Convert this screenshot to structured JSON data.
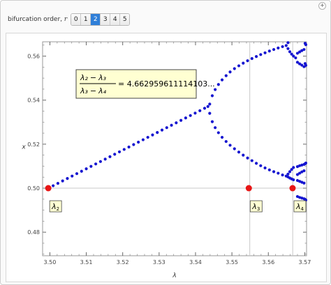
{
  "controls": {
    "label": "bifurcation order,",
    "var": "r",
    "options": [
      "0",
      "1",
      "2",
      "3",
      "4",
      "5"
    ],
    "selected": "2",
    "add_icon": "plus-icon"
  },
  "chart_data": {
    "type": "scatter",
    "xlabel": "λ",
    "ylabel": "x",
    "xlim": [
      3.498,
      3.5705
    ],
    "ylim": [
      0.4693,
      0.5665
    ],
    "xticks": [
      "3.50",
      "3.51",
      "3.52",
      "3.53",
      "3.54",
      "3.55",
      "3.56",
      "3.57"
    ],
    "yticks": [
      "0.48",
      "0.50",
      "0.52",
      "0.54",
      "0.56"
    ],
    "grid": false,
    "colors": {
      "points": "#1515d0",
      "markers": "#e81515",
      "label_bg": "#ffffd2"
    },
    "reference_lines": {
      "horizontal_y": 0.5,
      "vertical_x": [
        3.5549,
        3.5667
      ]
    },
    "formula": {
      "num_a": "λ₂",
      "num_b": "λ₃",
      "den_a": "λ₃",
      "den_b": "λ₄",
      "op": "−",
      "eq": "=",
      "value": "4.662959611114103..."
    },
    "markers": [
      {
        "label_main": "λ",
        "label_sub": "2",
        "x": 3.49956,
        "y": 0.5
      },
      {
        "label_main": "λ",
        "label_sub": "3",
        "x": 3.55464,
        "y": 0.5
      },
      {
        "label_main": "λ",
        "label_sub": "4",
        "x": 3.56666,
        "y": 0.5
      }
    ],
    "series_points": [
      [
        3.4996,
        0.5
      ],
      [
        3.5009,
        0.5011
      ],
      [
        3.5022,
        0.5022
      ],
      [
        3.5035,
        0.5033
      ],
      [
        3.5048,
        0.5044
      ],
      [
        3.5061,
        0.5055
      ],
      [
        3.5074,
        0.5066
      ],
      [
        3.5087,
        0.5077
      ],
      [
        3.51,
        0.5088
      ],
      [
        3.5113,
        0.5099
      ],
      [
        3.5126,
        0.511
      ],
      [
        3.5139,
        0.5121
      ],
      [
        3.5152,
        0.5132
      ],
      [
        3.5165,
        0.5143
      ],
      [
        3.5178,
        0.5154
      ],
      [
        3.5191,
        0.5165
      ],
      [
        3.5204,
        0.5176
      ],
      [
        3.5217,
        0.5187
      ],
      [
        3.523,
        0.5198
      ],
      [
        3.5243,
        0.5209
      ],
      [
        3.5256,
        0.522
      ],
      [
        3.5269,
        0.5231
      ],
      [
        3.5282,
        0.5242
      ],
      [
        3.5295,
        0.5253
      ],
      [
        3.5308,
        0.5264
      ],
      [
        3.5321,
        0.5275
      ],
      [
        3.5334,
        0.5286
      ],
      [
        3.5347,
        0.5297
      ],
      [
        3.536,
        0.5308
      ],
      [
        3.5373,
        0.5319
      ],
      [
        3.5386,
        0.533
      ],
      [
        3.5399,
        0.5341
      ],
      [
        3.5412,
        0.5352
      ],
      [
        3.5425,
        0.5363
      ],
      [
        3.5434,
        0.5371
      ],
      [
        3.5439,
        0.5382
      ],
      [
        3.5446,
        0.542
      ],
      [
        3.5454,
        0.5448
      ],
      [
        3.5463,
        0.5471
      ],
      [
        3.5473,
        0.5492
      ],
      [
        3.5484,
        0.5511
      ],
      [
        3.5495,
        0.5528
      ],
      [
        3.5507,
        0.5543
      ],
      [
        3.5519,
        0.5556
      ],
      [
        3.5531,
        0.5568
      ],
      [
        3.5543,
        0.5579
      ],
      [
        3.5555,
        0.5589
      ],
      [
        3.5567,
        0.5598
      ],
      [
        3.5579,
        0.5607
      ],
      [
        3.5591,
        0.5615
      ],
      [
        3.5603,
        0.5623
      ],
      [
        3.5615,
        0.563
      ],
      [
        3.5627,
        0.5637
      ],
      [
        3.5639,
        0.5643
      ],
      [
        3.5649,
        0.5648
      ],
      [
        3.5439,
        0.534
      ],
      [
        3.5446,
        0.5302
      ],
      [
        3.5454,
        0.5275
      ],
      [
        3.5463,
        0.5252
      ],
      [
        3.5473,
        0.5231
      ],
      [
        3.5484,
        0.5212
      ],
      [
        3.5495,
        0.5195
      ],
      [
        3.5507,
        0.5179
      ],
      [
        3.5519,
        0.5164
      ],
      [
        3.5531,
        0.515
      ],
      [
        3.5543,
        0.5137
      ],
      [
        3.5555,
        0.5125
      ],
      [
        3.5567,
        0.5113
      ],
      [
        3.5579,
        0.5102
      ],
      [
        3.5591,
        0.5092
      ],
      [
        3.5603,
        0.5083
      ],
      [
        3.5615,
        0.5075
      ],
      [
        3.5627,
        0.5068
      ],
      [
        3.5639,
        0.506
      ],
      [
        3.5649,
        0.5055
      ],
      [
        3.5654,
        0.5661
      ],
      [
        3.5659,
        0.5676
      ],
      [
        3.5664,
        0.5688
      ],
      [
        3.5669,
        0.5697
      ],
      [
        3.5675,
        0.5706
      ],
      [
        3.5654,
        0.5634
      ],
      [
        3.5659,
        0.562
      ],
      [
        3.5664,
        0.5609
      ],
      [
        3.5669,
        0.56
      ],
      [
        3.5675,
        0.5592
      ],
      [
        3.5654,
        0.5051
      ],
      [
        3.5659,
        0.5046
      ],
      [
        3.5664,
        0.5042
      ],
      [
        3.5669,
        0.5038
      ],
      [
        3.5654,
        0.5064
      ],
      [
        3.5659,
        0.5075
      ],
      [
        3.5664,
        0.5085
      ],
      [
        3.5669,
        0.5094
      ],
      [
        3.568,
        0.5613
      ],
      [
        3.5686,
        0.5619
      ],
      [
        3.5692,
        0.5625
      ],
      [
        3.5698,
        0.563
      ],
      [
        3.568,
        0.5572
      ],
      [
        3.5686,
        0.5565
      ],
      [
        3.5692,
        0.5559
      ],
      [
        3.5698,
        0.5552
      ],
      [
        3.568,
        0.5062
      ],
      [
        3.5686,
        0.5068
      ],
      [
        3.5692,
        0.5074
      ],
      [
        3.5698,
        0.5079
      ],
      [
        3.568,
        0.5035
      ],
      [
        3.5686,
        0.5031
      ],
      [
        3.5692,
        0.5027
      ],
      [
        3.5698,
        0.5023
      ],
      [
        3.568,
        0.5098
      ],
      [
        3.5686,
        0.5102
      ],
      [
        3.5692,
        0.5105
      ],
      [
        3.5698,
        0.5108
      ],
      [
        3.568,
        0.4962
      ],
      [
        3.5686,
        0.4958
      ],
      [
        3.5692,
        0.4955
      ],
      [
        3.5698,
        0.4952
      ],
      [
        3.5701,
        0.5658
      ],
      [
        3.5703,
        0.5652
      ],
      [
        3.5701,
        0.5566
      ],
      [
        3.5703,
        0.5558
      ],
      [
        3.5701,
        0.5111
      ],
      [
        3.5703,
        0.5114
      ],
      [
        3.5701,
        0.4949
      ],
      [
        3.5703,
        0.4946
      ]
    ]
  }
}
